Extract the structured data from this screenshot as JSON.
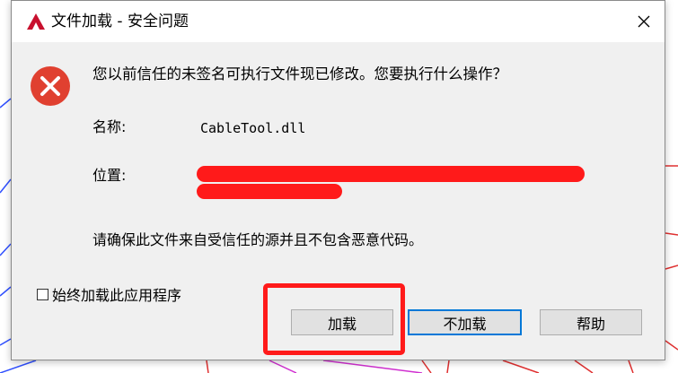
{
  "dialog": {
    "title": "文件加载 - 安全问题",
    "close_symbol": "×",
    "question": "您以前信任的未签名可执行文件现已修改。您要执行什么操作？",
    "name_label": "名称:",
    "name_value": "CableTool.dll",
    "location_label": "位置:",
    "location_value": "",
    "note": "请确保此文件来自受信任的源并且不包含恶意代码。",
    "checkbox_label": "始终加载此应用程序",
    "checkbox_checked": false,
    "buttons": {
      "load": "加载",
      "no_load": "不加载",
      "help": "帮助"
    }
  },
  "colors": {
    "error_red": "#e04030",
    "redaction_red": "#ff1a1a",
    "focus_blue": "#0078d7",
    "dialog_bg": "#f0f0f0"
  },
  "icons": {
    "app": "autocad-logo-icon",
    "error": "error-x-icon",
    "close": "close-icon"
  }
}
